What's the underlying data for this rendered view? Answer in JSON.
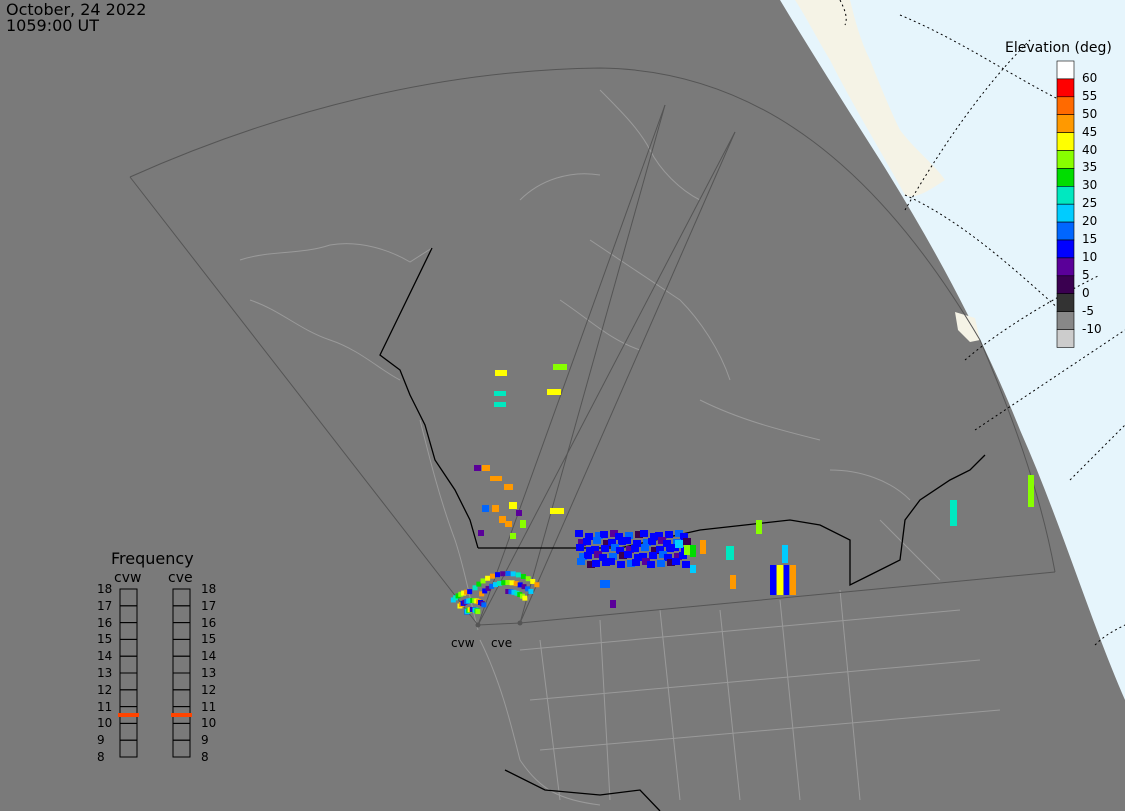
{
  "header": {
    "date": "October, 24 2022",
    "time": "1059:00 UT"
  },
  "legend": {
    "title": "Elevation (deg)",
    "labels": [
      "60",
      "55",
      "50",
      "45",
      "40",
      "35",
      "30",
      "25",
      "20",
      "15",
      "10",
      "5",
      "0",
      "-5",
      "-10"
    ],
    "colors": [
      "#ffffff",
      "#ff0000",
      "#ff6a00",
      "#ff9900",
      "#ffff00",
      "#88ff00",
      "#00dd00",
      "#00e8c0",
      "#00ccff",
      "#0066ff",
      "#0000ff",
      "#5a0099",
      "#3a0050",
      "#333333",
      "#888888",
      "#cccccc"
    ]
  },
  "frequency": {
    "title": "Frequency",
    "radars": [
      "cvw",
      "cve"
    ],
    "ticks": [
      "18",
      "17",
      "16",
      "15",
      "14",
      "13",
      "12",
      "11",
      "10",
      "9",
      "8"
    ],
    "values_mhz": [
      10.5,
      10.5
    ],
    "marker_color": "#ff4400"
  },
  "sites": {
    "west": "cvw",
    "east": "cve"
  },
  "map": {
    "ocean_color": "#e6f5fc",
    "land_color": "#f5f3e6",
    "night_color": "#7a7a7a",
    "border_color": "#000000",
    "outline_color": "#9a9a9a"
  }
}
